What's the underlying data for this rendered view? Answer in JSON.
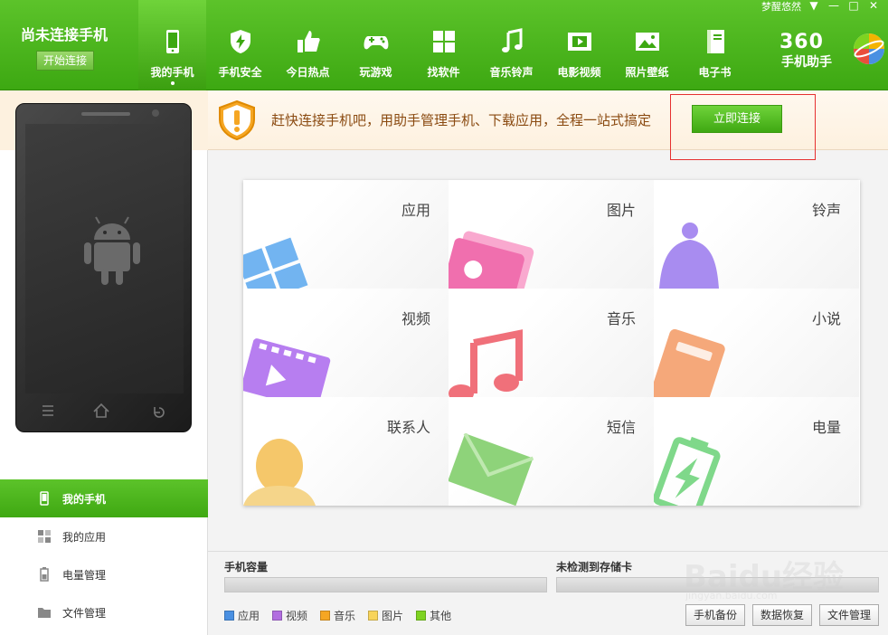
{
  "header": {
    "status_text": "尚未连接手机",
    "connect_button": "开始连接",
    "user_name": "梦醒悠然",
    "brand_360": "360",
    "brand_sub": "手机助手",
    "nav": [
      {
        "label": "我的手机",
        "icon": "phone-icon",
        "active": true
      },
      {
        "label": "手机安全",
        "icon": "shield-bolt-icon"
      },
      {
        "label": "今日热点",
        "icon": "thumbs-up-icon"
      },
      {
        "label": "玩游戏",
        "icon": "gamepad-icon"
      },
      {
        "label": "找软件",
        "icon": "grid-apps-icon"
      },
      {
        "label": "音乐铃声",
        "icon": "music-note-icon"
      },
      {
        "label": "电影视频",
        "icon": "film-icon"
      },
      {
        "label": "照片壁纸",
        "icon": "picture-icon"
      },
      {
        "label": "电子书",
        "icon": "book-icon"
      }
    ]
  },
  "notice": {
    "text": "赶快连接手机吧，用助手管理手机、下载应用，全程一站式搞定",
    "button": "立即连接"
  },
  "sidebar": {
    "items": [
      {
        "label": "我的手机",
        "icon": "phone-icon",
        "active": true
      },
      {
        "label": "我的应用",
        "icon": "apps-icon"
      },
      {
        "label": "电量管理",
        "icon": "battery-icon"
      },
      {
        "label": "文件管理",
        "icon": "folder-icon"
      }
    ]
  },
  "grid": {
    "cells": [
      {
        "label": "应用",
        "icon": "apps-tile-icon",
        "color": "#5aa8ef"
      },
      {
        "label": "图片",
        "icon": "photo-tile-icon",
        "color": "#f06fae"
      },
      {
        "label": "铃声",
        "icon": "bell-tile-icon",
        "color": "#a88cf0"
      },
      {
        "label": "视频",
        "icon": "video-tile-icon",
        "color": "#b77ef0"
      },
      {
        "label": "音乐",
        "icon": "music-tile-icon",
        "color": "#f0707a"
      },
      {
        "label": "小说",
        "icon": "novel-tile-icon",
        "color": "#f5a87a"
      },
      {
        "label": "联系人",
        "icon": "contact-tile-icon",
        "color": "#f5c76a"
      },
      {
        "label": "短信",
        "icon": "sms-tile-icon",
        "color": "#8ed37a"
      },
      {
        "label": "电量",
        "icon": "battery-tile-icon",
        "color": "#7fd88a"
      }
    ]
  },
  "storage": {
    "phone_capacity": "手机容量",
    "sd_card": "未检测到存储卡",
    "legend": [
      {
        "label": "应用",
        "color": "#4a90e2"
      },
      {
        "label": "视频",
        "color": "#b26ee0"
      },
      {
        "label": "音乐",
        "color": "#f5a623"
      },
      {
        "label": "图片",
        "color": "#f8d45a"
      },
      {
        "label": "其他",
        "color": "#7ed321"
      }
    ],
    "buttons": [
      "手机备份",
      "数据恢复",
      "文件管理"
    ]
  },
  "watermark": {
    "text": "Baidu经验",
    "sub": "jingyan.baidu.com"
  }
}
